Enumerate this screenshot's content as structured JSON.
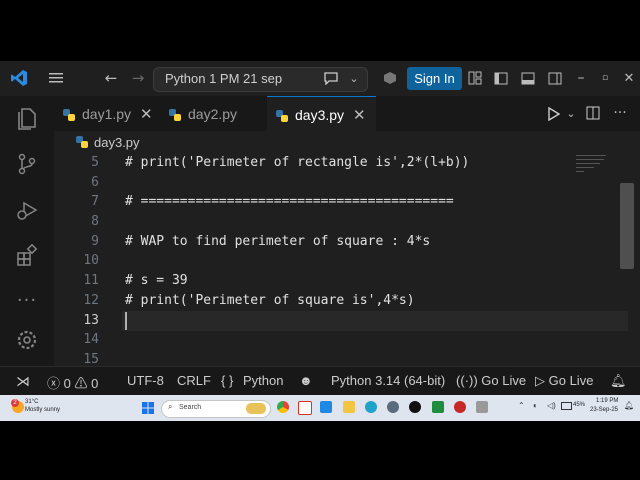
{
  "titlebar": {
    "command_center": "Python 1 PM 21 sep",
    "sign_in": "Sign In"
  },
  "tabs": [
    {
      "label": "day1.py",
      "active": false
    },
    {
      "label": "day2.py",
      "active": false
    },
    {
      "label": "day3.py",
      "active": true
    }
  ],
  "breadcrumb": {
    "file": "day3.py"
  },
  "editor": {
    "lines": [
      {
        "number": "5",
        "text": "# print('Perimeter of rectangle is',2*(l+b))"
      },
      {
        "number": "6",
        "text": ""
      },
      {
        "number": "7",
        "text": "# ========================================"
      },
      {
        "number": "8",
        "text": ""
      },
      {
        "number": "9",
        "text": "# WAP to find perimeter of square : 4*s"
      },
      {
        "number": "10",
        "text": ""
      },
      {
        "number": "11",
        "text": "# s = 39"
      },
      {
        "number": "12",
        "text": "# print('Perimeter of square is',4*s)"
      },
      {
        "number": "13",
        "text": ""
      },
      {
        "number": "14",
        "text": ""
      },
      {
        "number": "15",
        "text": ""
      }
    ],
    "current_line": "13"
  },
  "statusbar": {
    "errors": "0",
    "warnings": "0",
    "encoding": "UTF-8",
    "eol": "CRLF",
    "language": "Python",
    "interpreter": "Python 3.14 (64-bit)",
    "go_live_1": "Go Live",
    "go_live_2": "Go Live"
  },
  "taskbar": {
    "weather_temp": "31°C",
    "weather_desc": "Mostly sunny",
    "weather_badge": "2",
    "search_placeholder": "Search",
    "battery": "45%",
    "time": "1:19 PM",
    "date": "23-Sep-25"
  },
  "colors": {
    "accent": "#0078d4",
    "sign_in_bg": "#0e639c",
    "editor_bg": "#1f1f1f",
    "python_blue": "#3572A5",
    "python_yellow": "#ffd43b"
  }
}
